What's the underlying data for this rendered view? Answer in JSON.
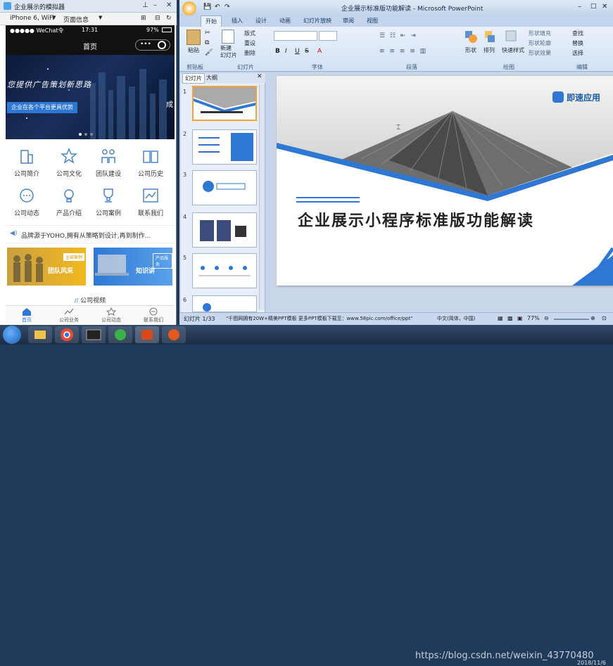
{
  "simulator": {
    "title": "企业展示的模拟器",
    "device": "iPhone 6, WiFi",
    "page_info": "页面信息",
    "status": {
      "carrier": "●●●●● WeChat令",
      "time": "17:31",
      "battery": "97%"
    },
    "nav_title": "首页",
    "banner": {
      "line1": "您提供广告策划新思路",
      "line2": "企业在各个平台更具优势",
      "side_char": "成"
    },
    "grid": [
      {
        "label": "公司简介",
        "icon": "building-icon"
      },
      {
        "label": "公司文化",
        "icon": "star-icon"
      },
      {
        "label": "团队建设",
        "icon": "team-icon"
      },
      {
        "label": "公司历史",
        "icon": "book-icon"
      },
      {
        "label": "公司动态",
        "icon": "chat-icon"
      },
      {
        "label": "产品介绍",
        "icon": "bulb-icon"
      },
      {
        "label": "公司案例",
        "icon": "trophy-icon"
      },
      {
        "label": "联系我们",
        "icon": "chart-icon"
      }
    ],
    "notice": "品牌源于YOHO,拥有从策略到设计,再到制作...",
    "cards": [
      {
        "title": "团队风采",
        "tag": "全部案例"
      },
      {
        "title": "知识讲",
        "tag": "产品服务"
      }
    ],
    "section_title": "公司视频",
    "tabs": [
      "首页",
      "公司业务",
      "公司动态",
      "联系我们"
    ],
    "colors": {
      "primary": "#2e78d4",
      "accent": "#f0a500"
    }
  },
  "ppt": {
    "title": "企业展示标准版功能解读 - Microsoft PowerPoint",
    "ribbon_tabs": [
      "开始",
      "插入",
      "设计",
      "动画",
      "幻灯片放映",
      "审阅",
      "视图"
    ],
    "groups": [
      "剪贴板",
      "幻灯片",
      "字体",
      "段落",
      "绘图",
      "编辑"
    ],
    "ribbon_labels": {
      "paste": "粘贴",
      "new_slide": "新建\n幻灯片",
      "layout": "版式",
      "reset": "重设",
      "delete": "删除",
      "shape": "形状",
      "arrange": "排列",
      "quick_style": "快速样式",
      "shape_fill": "形状填充",
      "shape_outline": "形状轮廓",
      "shape_effect": "形状效果",
      "find": "查找",
      "replace": "替换",
      "select": "选择"
    },
    "panel_tabs": [
      "幻灯片",
      "大纲"
    ],
    "thumb_numbers": [
      "1",
      "2",
      "3",
      "4",
      "5",
      "6"
    ],
    "slide": {
      "title": "企业展示小程序标准版功能解读",
      "brand": "即速应用"
    },
    "status": {
      "slide_pos": "幻灯片 1/33",
      "theme": "\"千图网拥有20W+精美PPT模板 更多PPT模板下载至：www.58pic.com/office/ppt\"",
      "lang": "中文(简体，中国)",
      "zoom": "77%"
    }
  },
  "taskbar": {
    "watermark": "https://blog.csdn.net/weixin_43770480",
    "date": "2018/11/6"
  }
}
